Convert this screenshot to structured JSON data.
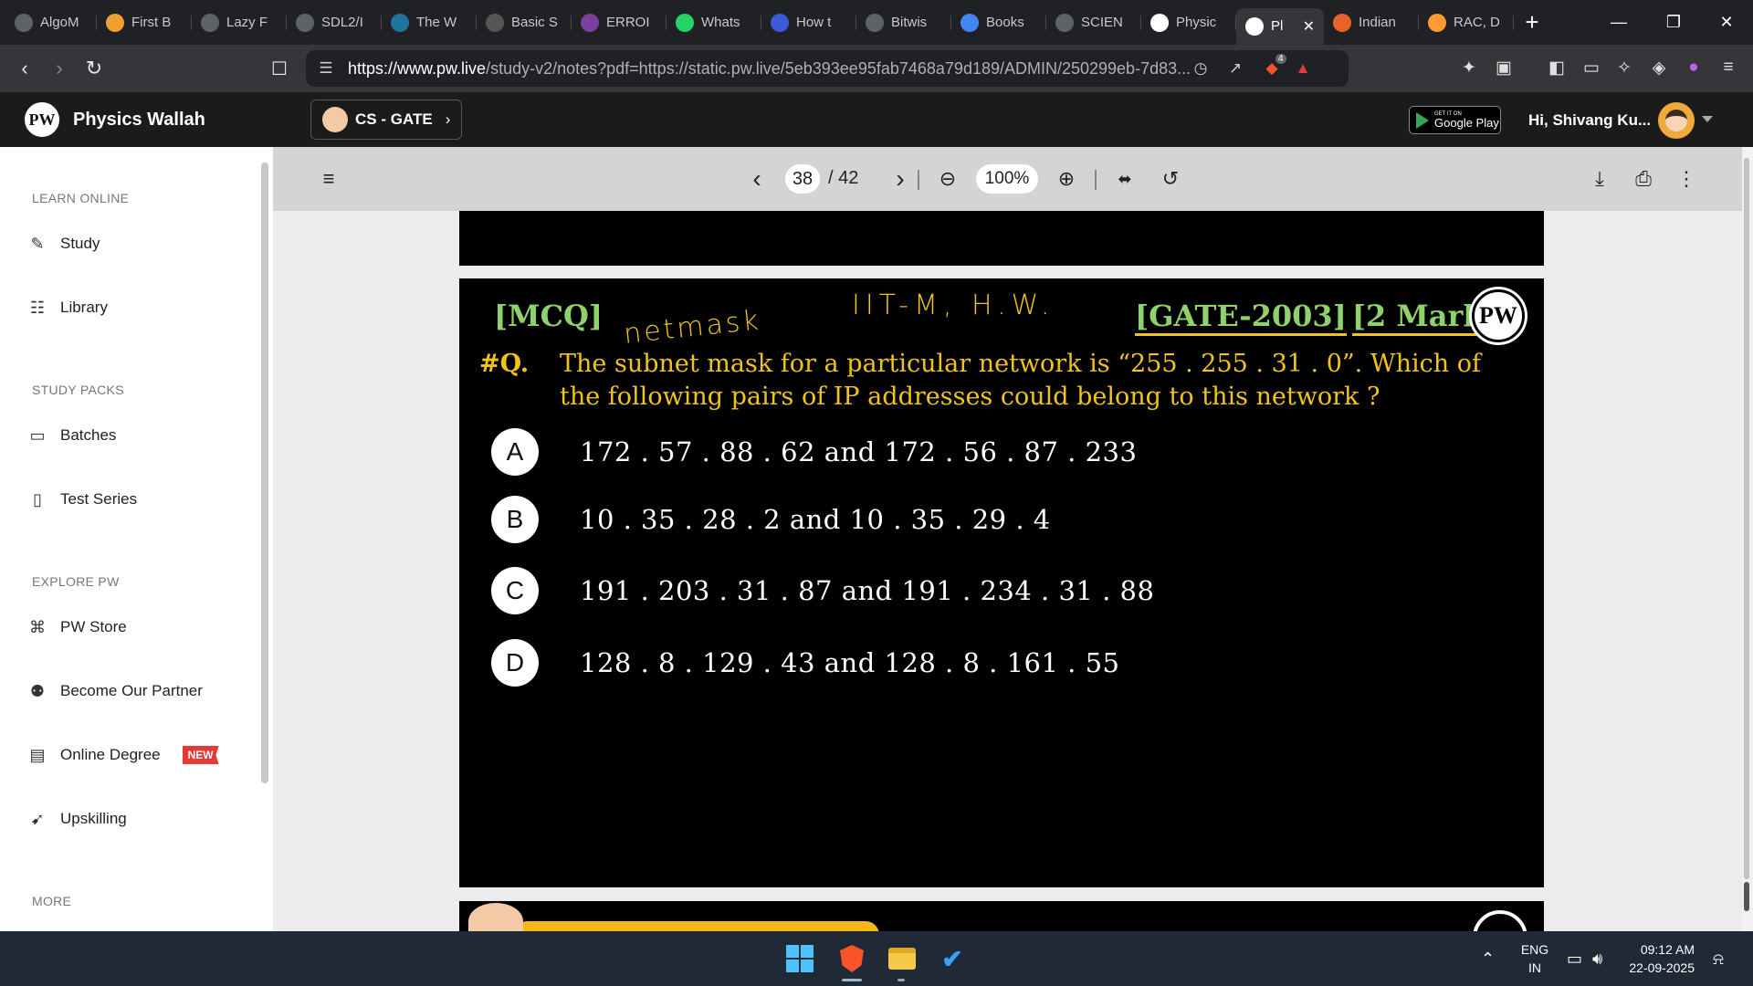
{
  "browser": {
    "tabs": [
      {
        "label": "AlgoM",
        "icon": "algomonster-icon",
        "color": "#5f6368"
      },
      {
        "label": "First B",
        "icon": "bolt-icon",
        "color": "#f0a030"
      },
      {
        "label": "Lazy F",
        "icon": "globe-icon",
        "color": "#5f6368"
      },
      {
        "label": "SDL2/I",
        "icon": "globe-icon",
        "color": "#5f6368"
      },
      {
        "label": "The W",
        "icon": "wordpress-icon",
        "color": "#21759b"
      },
      {
        "label": "Basic S",
        "icon": "window-icon",
        "color": "#555"
      },
      {
        "label": "ERROI",
        "icon": "purple-logo-icon",
        "color": "#7b3fa0"
      },
      {
        "label": "Whats",
        "icon": "whatsapp-icon",
        "color": "#25d366"
      },
      {
        "label": "How t",
        "icon": "shield-blue-icon",
        "color": "#3b5bdb"
      },
      {
        "label": "Bitwis",
        "icon": "grip-icon",
        "color": "#5f6368"
      },
      {
        "label": "Books",
        "icon": "google-icon",
        "color": "#4285f4"
      },
      {
        "label": "SCIEN",
        "icon": "globe-icon",
        "color": "#5f6368"
      },
      {
        "label": "Physic",
        "icon": "pw-icon",
        "color": "#ffffff"
      },
      {
        "label": "Pl",
        "icon": "pw-icon",
        "color": "#ffffff",
        "active": true
      },
      {
        "label": "Indian",
        "icon": "orange-icon",
        "color": "#e8632b"
      },
      {
        "label": "RAC, D",
        "icon": "india-flag-icon",
        "color": "#ff9933"
      }
    ],
    "url_host": "https://www.pw.live",
    "url_rest": "/study-v2/notes?pdf=https://static.pw.live/5eb393ee95fab7468a79d189/ADMIN/250299eb-7d83...",
    "shield_count": "4"
  },
  "header": {
    "brand": "Physics Wallah",
    "logo_text": "PW",
    "course": "CS - GATE",
    "gplay_small": "GET IT ON",
    "gplay_big": "Google Play",
    "greeting": "Hi, Shivang Ku..."
  },
  "sidebar": {
    "sections": [
      {
        "title": "LEARN ONLINE",
        "items": [
          {
            "label": "Study",
            "icon": "edit-icon"
          },
          {
            "label": "Library",
            "icon": "book-icon"
          }
        ]
      },
      {
        "title": "STUDY PACKS",
        "items": [
          {
            "label": "Batches",
            "icon": "monitor-icon"
          },
          {
            "label": "Test Series",
            "icon": "clipboard-icon"
          }
        ]
      },
      {
        "title": "EXPLORE PW",
        "items": [
          {
            "label": "PW Store",
            "icon": "cart-icon"
          },
          {
            "label": "Become Our Partner",
            "icon": "partner-icon"
          },
          {
            "label": "Online Degree",
            "icon": "degree-icon",
            "badge": "NEW"
          },
          {
            "label": "Upskilling",
            "icon": "rocket-icon"
          }
        ]
      },
      {
        "title": "MORE",
        "items": []
      }
    ]
  },
  "viewer": {
    "page_current": "38",
    "page_total": "/ 42",
    "zoom": "100%"
  },
  "slide": {
    "tag": "[MCQ]",
    "source_year": "[GATE-2003]",
    "marks": "[2 Mark]",
    "pw_badge": "PW",
    "annotation_netmask": "netmask",
    "annotation_iitm": "IIT-M, H.W.",
    "qnum": "#Q.",
    "question": "The subnet mask for a particular network is “255 . 255 . 31 . 0”. Which of the following pairs of IP addresses could belong to this network ?",
    "options": [
      {
        "letter": "A",
        "text": "172 . 57 . 88 . 62 and 172 . 56 . 87 . 233"
      },
      {
        "letter": "B",
        "text": "10 . 35 . 28 . 2 and 10 . 35 . 29 . 4"
      },
      {
        "letter": "C",
        "text": "191 . 203 . 31 . 87 and 191 . 234 . 31 . 88"
      },
      {
        "letter": "D",
        "text": "128 . 8 . 129 . 43 and 128 . 8 . 161 . 55"
      }
    ]
  },
  "taskbar": {
    "lang_line1": "ENG",
    "lang_line2": "IN",
    "time": "09:12 AM",
    "date": "22-09-2025"
  }
}
